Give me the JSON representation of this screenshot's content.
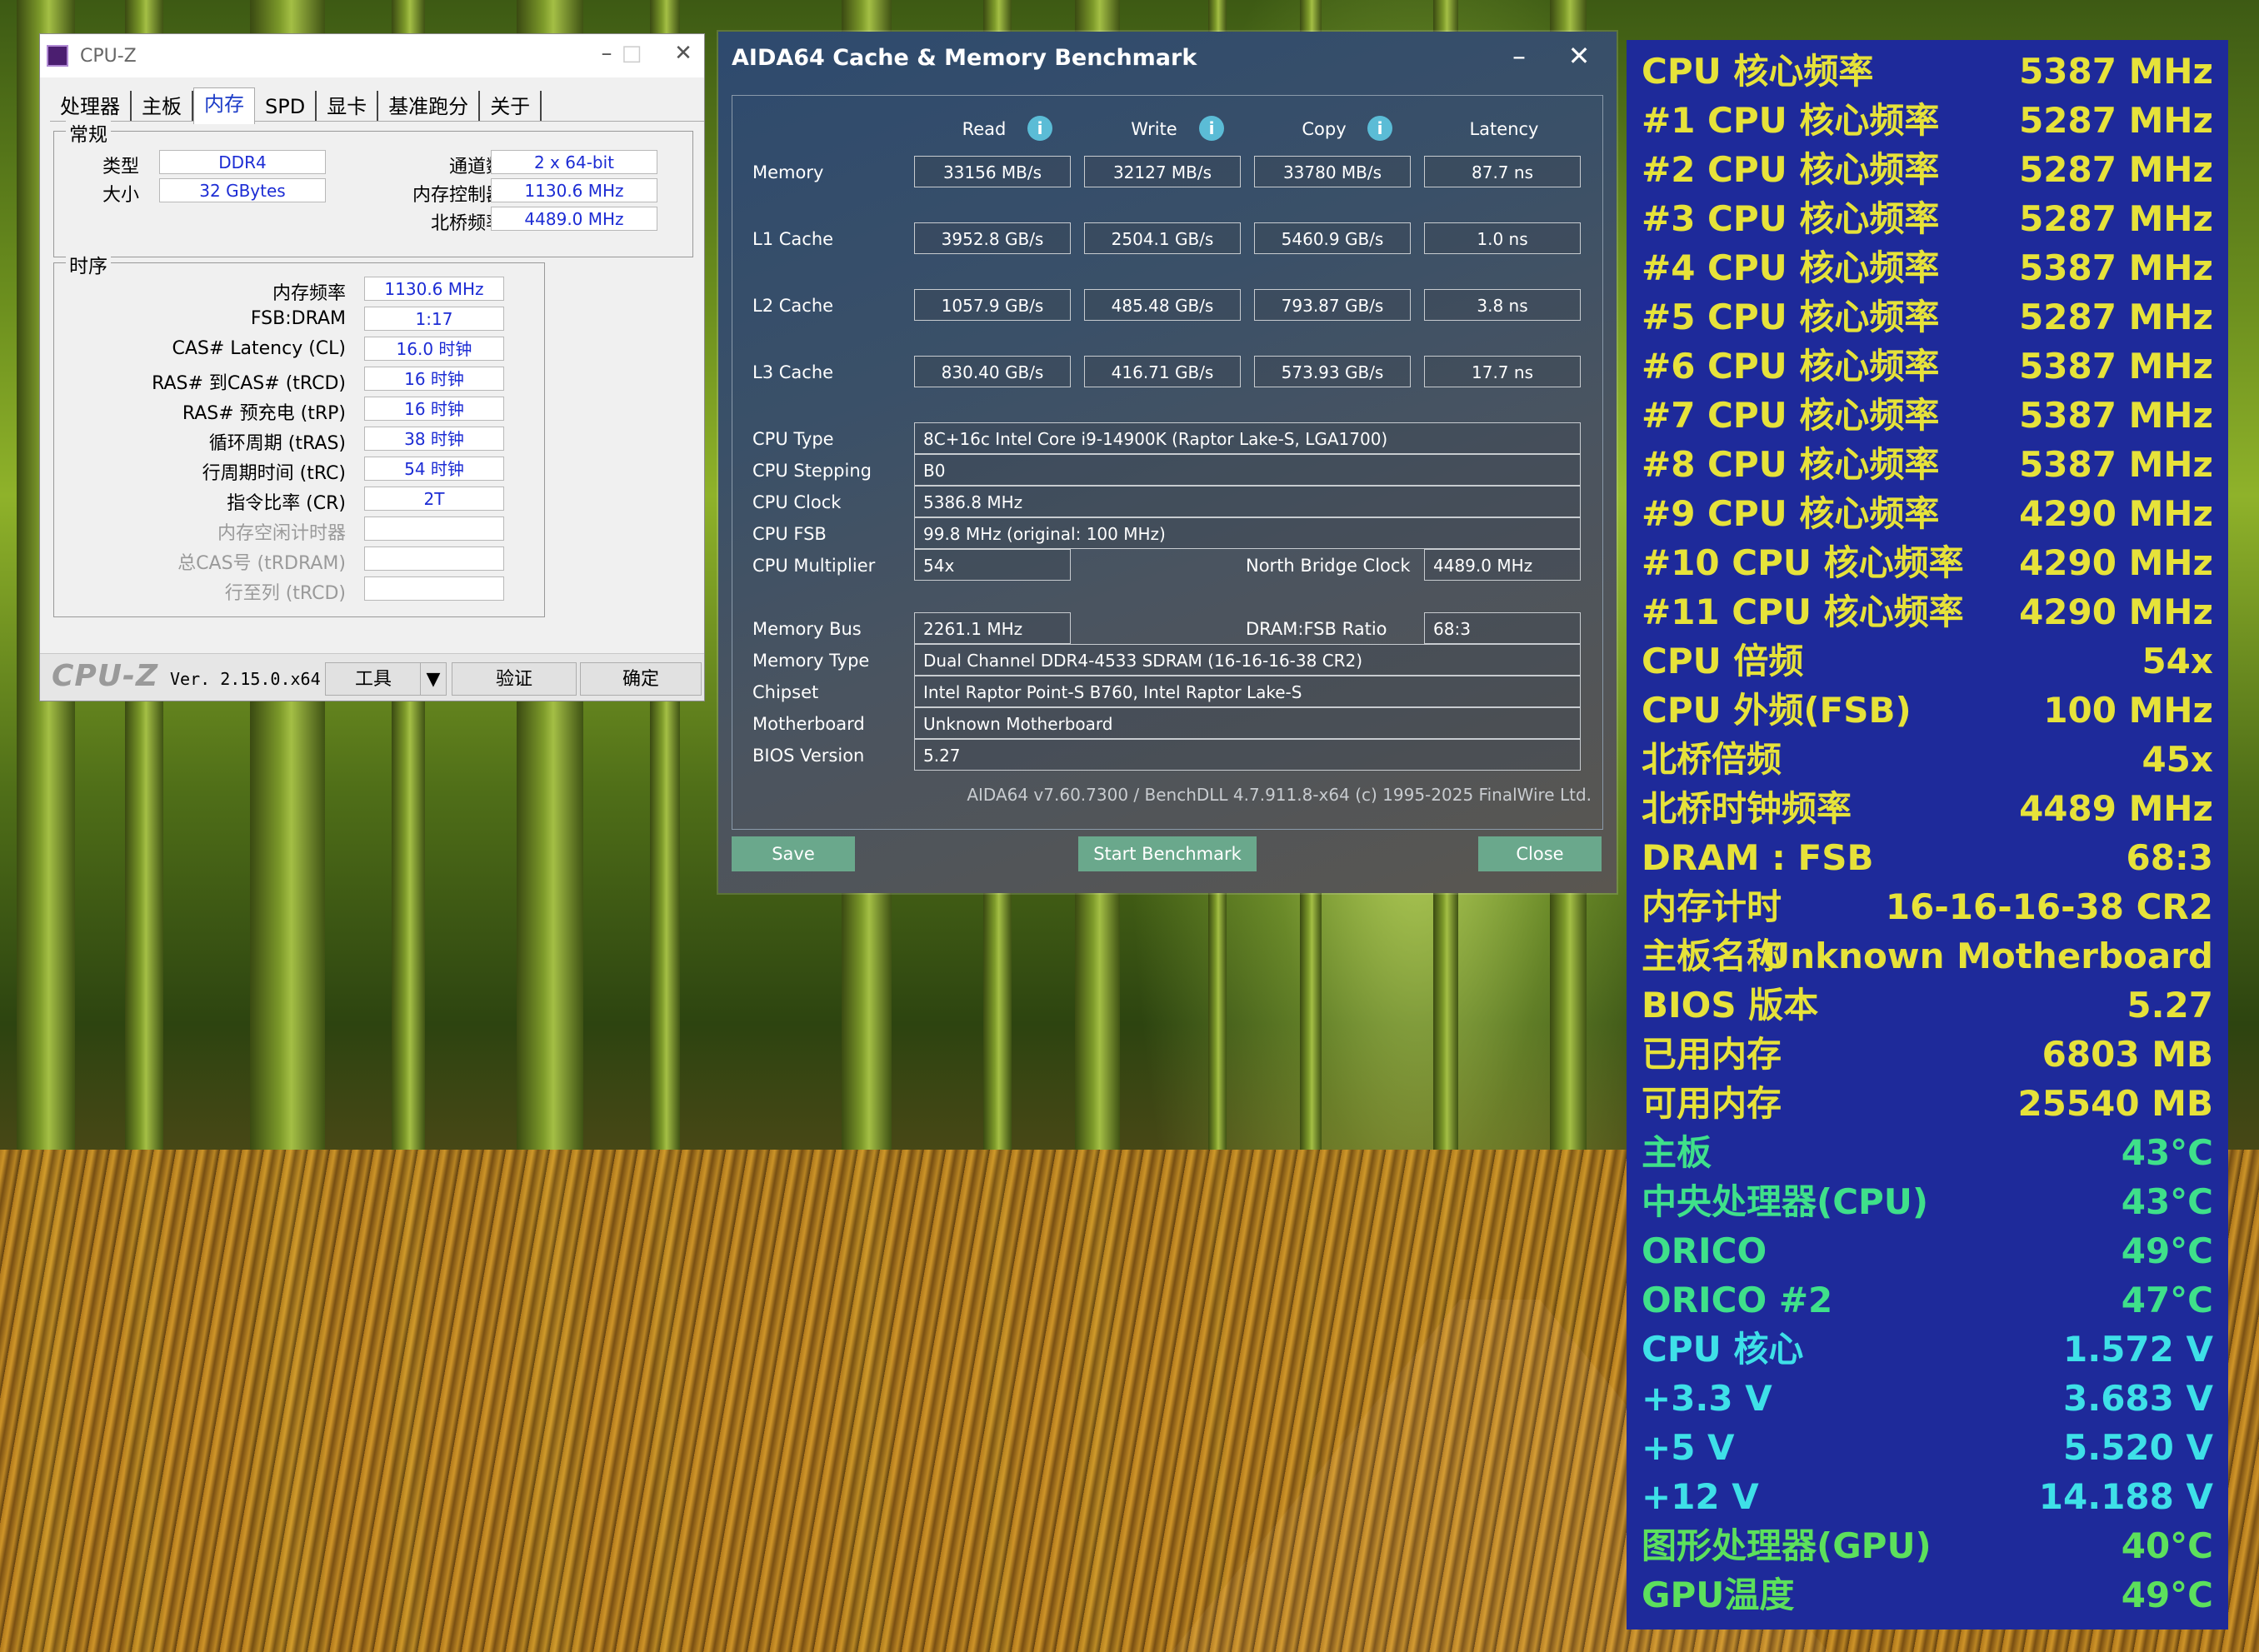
{
  "cpuz": {
    "title": "CPU-Z",
    "tabs": [
      "处理器",
      "主板",
      "内存",
      "SPD",
      "显卡",
      "基准跑分",
      "关于"
    ],
    "active_tab": "内存",
    "general": {
      "title": "常规",
      "type_label": "类型",
      "type_value": "DDR4",
      "size_label": "大小",
      "size_value": "32 GBytes",
      "channels_label": "通道数",
      "channels_value": "2 x 64-bit",
      "mc_label": "内存控制器",
      "mc_value": "1130.6 MHz",
      "nb_label": "北桥频率",
      "nb_value": "4489.0 MHz"
    },
    "timings": {
      "title": "时序",
      "rows": [
        {
          "label": "内存频率",
          "value": "1130.6 MHz"
        },
        {
          "label": "FSB:DRAM",
          "value": "1:17"
        },
        {
          "label": "CAS# Latency (CL)",
          "value": "16.0 时钟"
        },
        {
          "label": "RAS# 到CAS# (tRCD)",
          "value": "16 时钟"
        },
        {
          "label": "RAS# 预充电 (tRP)",
          "value": "16 时钟"
        },
        {
          "label": "循环周期 (tRAS)",
          "value": "38 时钟"
        },
        {
          "label": "行周期时间 (tRC)",
          "value": "54 时钟"
        },
        {
          "label": "指令比率 (CR)",
          "value": "2T"
        },
        {
          "label": "内存空闲计时器",
          "value": ""
        },
        {
          "label": "总CAS号 (tRDRAM)",
          "value": ""
        },
        {
          "label": "行至列 (tRCD)",
          "value": ""
        }
      ]
    },
    "footer": {
      "logo": "CPU-Z",
      "version": "Ver. 2.15.0.x64",
      "tools_label": "工具",
      "validate_label": "验证",
      "ok_label": "确定"
    }
  },
  "aida": {
    "title": "AIDA64 Cache & Memory Benchmark",
    "columns": [
      "Read",
      "Write",
      "Copy",
      "Latency"
    ],
    "bench_rows": [
      {
        "label": "Memory",
        "values": [
          "33156 MB/s",
          "32127 MB/s",
          "33780 MB/s",
          "87.7 ns"
        ]
      },
      {
        "label": "L1 Cache",
        "values": [
          "3952.8 GB/s",
          "2504.1 GB/s",
          "5460.9 GB/s",
          "1.0 ns"
        ]
      },
      {
        "label": "L2 Cache",
        "values": [
          "1057.9 GB/s",
          "485.48 GB/s",
          "793.87 GB/s",
          "3.8 ns"
        ]
      },
      {
        "label": "L3 Cache",
        "values": [
          "830.40 GB/s",
          "416.71 GB/s",
          "573.93 GB/s",
          "17.7 ns"
        ]
      }
    ],
    "cpu_type_label": "CPU Type",
    "cpu_type": "8C+16c Intel Core i9-14900K  (Raptor Lake-S, LGA1700)",
    "cpu_stepping_label": "CPU Stepping",
    "cpu_stepping": "B0",
    "cpu_clock_label": "CPU Clock",
    "cpu_clock": "5386.8 MHz",
    "cpu_fsb_label": "CPU FSB",
    "cpu_fsb": "99.8 MHz  (original: 100 MHz)",
    "cpu_mult_label": "CPU Multiplier",
    "cpu_mult": "54x",
    "nb_clock_label": "North Bridge Clock",
    "nb_clock": "4489.0 MHz",
    "mem_bus_label": "Memory Bus",
    "mem_bus": "2261.1 MHz",
    "dram_ratio_label": "DRAM:FSB Ratio",
    "dram_ratio": "68:3",
    "mem_type_label": "Memory Type",
    "mem_type": "Dual Channel DDR4-4533 SDRAM  (16-16-16-38 CR2)",
    "chipset_label": "Chipset",
    "chipset": "Intel Raptor Point-S B760, Intel Raptor Lake-S",
    "mobo_label": "Motherboard",
    "mobo": "Unknown Motherboard",
    "bios_label": "BIOS Version",
    "bios": "5.27",
    "footer_text": "AIDA64 v7.60.7300 / BenchDLL 4.7.911.8-x64  (c) 1995-2025 FinalWire Ltd.",
    "save_label": "Save",
    "start_label": "Start Benchmark",
    "close_label": "Close"
  },
  "sensors": [
    {
      "label": "CPU 核心频率",
      "value": "5387 MHz",
      "color": "y"
    },
    {
      "label": "#1 CPU 核心频率",
      "value": "5287 MHz",
      "color": "y"
    },
    {
      "label": "#2 CPU 核心频率",
      "value": "5287 MHz",
      "color": "y"
    },
    {
      "label": "#3 CPU 核心频率",
      "value": "5287 MHz",
      "color": "y"
    },
    {
      "label": "#4 CPU 核心频率",
      "value": "5387 MHz",
      "color": "y"
    },
    {
      "label": "#5 CPU 核心频率",
      "value": "5287 MHz",
      "color": "y"
    },
    {
      "label": "#6 CPU 核心频率",
      "value": "5387 MHz",
      "color": "y"
    },
    {
      "label": "#7 CPU 核心频率",
      "value": "5387 MHz",
      "color": "y"
    },
    {
      "label": "#8 CPU 核心频率",
      "value": "5387 MHz",
      "color": "y"
    },
    {
      "label": "#9 CPU 核心频率",
      "value": "4290 MHz",
      "color": "y"
    },
    {
      "label": "#10 CPU 核心频率",
      "value": "4290 MHz",
      "color": "y"
    },
    {
      "label": "#11 CPU 核心频率",
      "value": "4290 MHz",
      "color": "y"
    },
    {
      "label": "CPU 倍频",
      "value": "54x",
      "color": "y"
    },
    {
      "label": "CPU 外频(FSB)",
      "value": "100 MHz",
      "color": "y"
    },
    {
      "label": "北桥倍频",
      "value": "45x",
      "color": "y"
    },
    {
      "label": "北桥时钟频率",
      "value": "4489 MHz",
      "color": "y"
    },
    {
      "label": "DRAM : FSB",
      "value": "68:3",
      "color": "y"
    },
    {
      "label": "内存计时",
      "value": "16-16-16-38 CR2",
      "color": "y"
    },
    {
      "label": "主板名称",
      "value": "Unknown Motherboard",
      "color": "y"
    },
    {
      "label": "BIOS 版本",
      "value": "5.27",
      "color": "y"
    },
    {
      "label": "已用内存",
      "value": "6803 MB",
      "color": "y"
    },
    {
      "label": "可用内存",
      "value": "25540 MB",
      "color": "y"
    },
    {
      "label": "主板",
      "value": "43°C",
      "color": "g"
    },
    {
      "label": "中央处理器(CPU)",
      "value": "43°C",
      "color": "g"
    },
    {
      "label": "ORICO",
      "value": "49°C",
      "color": "g"
    },
    {
      "label": "ORICO #2",
      "value": "47°C",
      "color": "g"
    },
    {
      "label": "CPU 核心",
      "value": "1.572 V",
      "color": "c"
    },
    {
      "label": "+3.3 V",
      "value": "3.683 V",
      "color": "c"
    },
    {
      "label": "+5 V",
      "value": "5.520 V",
      "color": "c"
    },
    {
      "label": "+12 V",
      "value": "14.188 V",
      "color": "c"
    },
    {
      "label": "图形处理器(GPU)",
      "value": "40°C",
      "color": "gg"
    },
    {
      "label": "GPU温度",
      "value": "49°C",
      "color": "gg"
    }
  ],
  "colors": {
    "sensor_bg": "#1e2a9a",
    "sensor_yellow": "#e6e23a",
    "sensor_green": "#3fe08a",
    "sensor_cyan": "#3ee0e8",
    "cpuz_value_blue": "#1c2cd4",
    "aida_button": "#6aa88c"
  }
}
